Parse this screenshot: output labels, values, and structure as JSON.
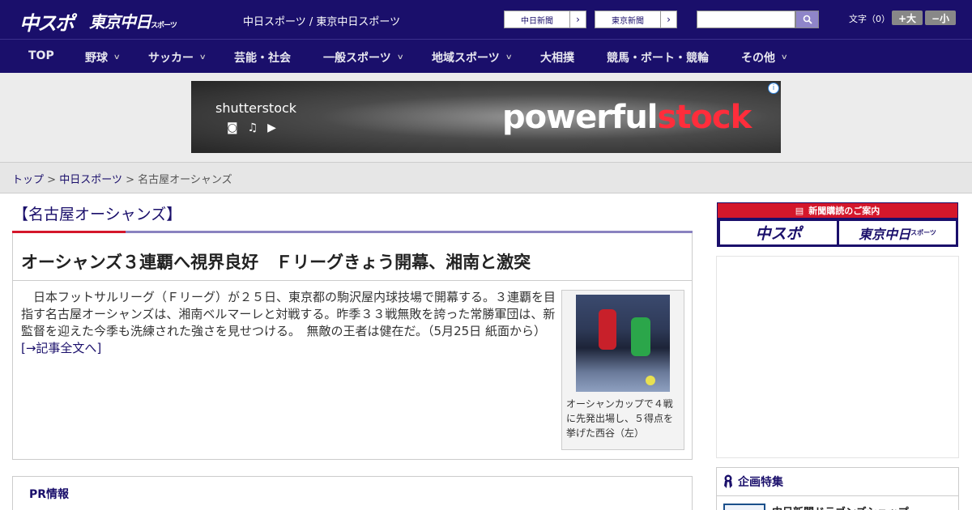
{
  "header": {
    "logo_chusupo": "中スポ",
    "logo_tokyo": "東京中日",
    "logo_tokyo_sub": "スポーツ",
    "site_title": "中日スポーツ / 東京中日スポーツ",
    "btn_chunichi": "中日新聞",
    "btn_tokyo": "東京新聞",
    "search_placeholder": "",
    "fontsize_label": "文字（0）",
    "fs_large": "+大",
    "fs_small": "−小"
  },
  "nav": {
    "items": [
      {
        "label": "TOP",
        "dropdown": false
      },
      {
        "label": "野球",
        "dropdown": true
      },
      {
        "label": "サッカー",
        "dropdown": true
      },
      {
        "label": "芸能・社会",
        "dropdown": false
      },
      {
        "label": "一般スポーツ",
        "dropdown": true
      },
      {
        "label": "地域スポーツ",
        "dropdown": true
      },
      {
        "label": "大相撲",
        "dropdown": false
      },
      {
        "label": "競馬・ボート・競輪",
        "dropdown": false
      },
      {
        "label": "その他",
        "dropdown": true
      }
    ]
  },
  "ad": {
    "brand": "shutterstock",
    "headline_pre": "powerful",
    "headline_accent": "stock",
    "info": "i"
  },
  "breadcrumb": {
    "home": "トップ",
    "sep": ">",
    "section": "中日スポーツ",
    "current": "名古屋オーシャンズ"
  },
  "section": {
    "title": "【名古屋オーシャンズ】"
  },
  "article": {
    "headline": "オーシャンズ３連覇へ視界良好　Ｆリーグきょう開幕、湘南と激突",
    "body": "　日本フットサルリーグ（Ｆリーグ）が２５日、東京都の駒沢屋内球技場で開幕する。３連覇を目指す名古屋オーシャンズは、湘南ベルマーレと対戦する。昨季３３戦無敗を誇った常勝軍団は、新監督を迎えた今季も洗練された強さを見せつける。　無敵の王者は健在だ。（5月25日 紙面から）　",
    "more_link": "[→記事全文へ]",
    "photo_caption": "オーシャンカップで４戦に先発出場し、５得点を挙げた西谷（左）"
  },
  "pr": {
    "title": "PR情報"
  },
  "sidebar": {
    "subscribe_title": "新聞購読のご案内",
    "sub_chusupo": "中スポ",
    "sub_tokyo": "東京中日",
    "sub_tokyo_small": "スポーツ",
    "feature_title": "企画特集",
    "feature_item": "中日新聞ドラゴンズショップ"
  }
}
